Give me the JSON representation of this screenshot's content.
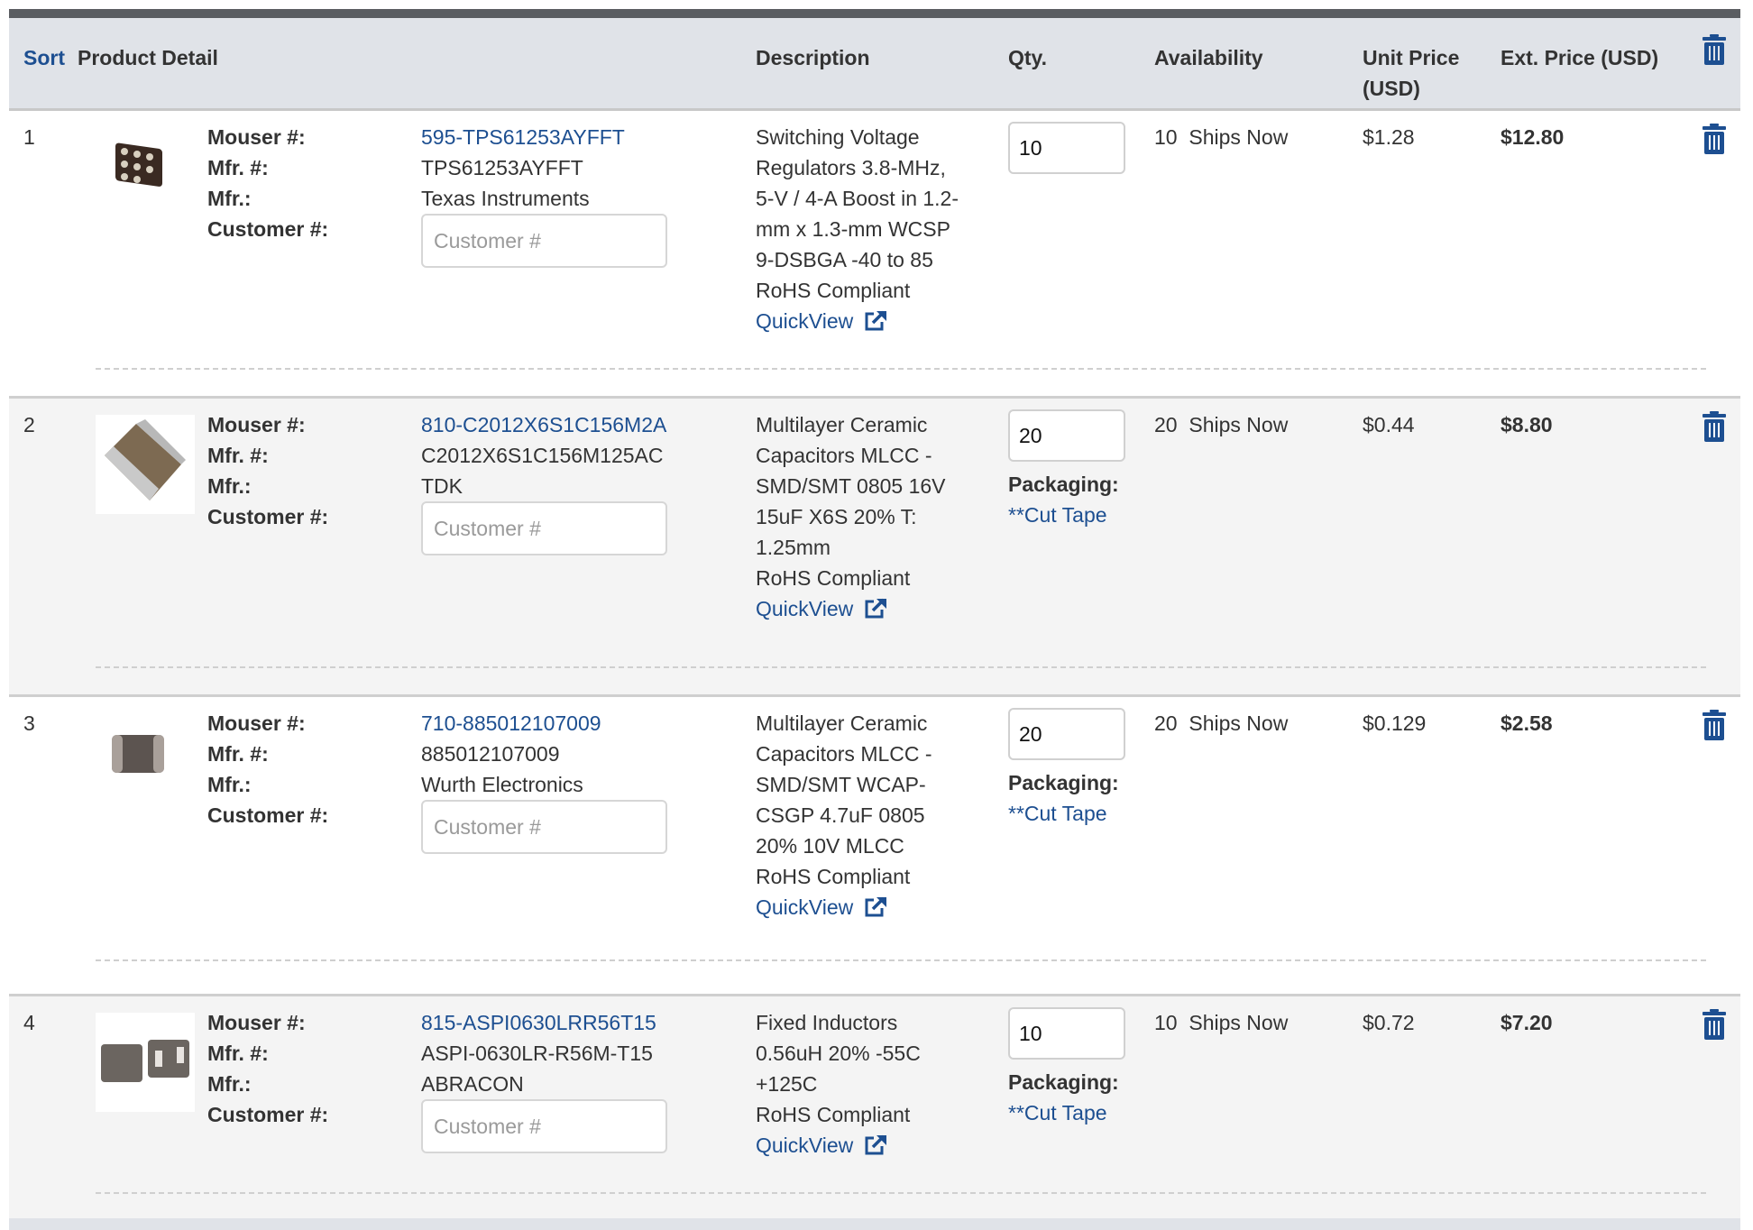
{
  "header": {
    "sort": "Sort",
    "product_detail": "Product Detail",
    "description": "Description",
    "qty": "Qty.",
    "availability": "Availability",
    "unit_price_line1": "Unit Price",
    "unit_price_line2": "(USD)",
    "ext_price": "Ext. Price (USD)",
    "delete_all_icon": "trash-icon"
  },
  "labels": {
    "mouser": "Mouser #:",
    "mfr_num": "Mfr. #:",
    "mfr": "Mfr.:",
    "customer": "Customer #:",
    "customer_placeholder": "Customer #",
    "packaging": "Packaging:",
    "quickview": "QuickView",
    "rohs": "RoHS Compliant"
  },
  "colors": {
    "link": "#1d4f91",
    "header_bg": "#e0e3e8",
    "topbar": "#5a5d61",
    "alt_row": "#f4f4f4"
  },
  "rows": [
    {
      "index": "1",
      "mouser_no": "595-TPS61253AYFFT",
      "mfr_no": "TPS61253AYFFT",
      "mfr": "Texas Instruments",
      "customer_no": "",
      "description": [
        "Switching Voltage",
        "Regulators 3.8-MHz,",
        "5-V / 4-A Boost in 1.2-",
        "mm x 1.3-mm WCSP",
        "9-DSBGA -40 to 85"
      ],
      "qty": "10",
      "packaging": "",
      "availability_qty": "10",
      "availability_text": "Ships Now",
      "unit_price": "$1.28",
      "ext_price": "$12.80"
    },
    {
      "index": "2",
      "mouser_no": "810-C2012X6S1C156M2A",
      "mfr_no": "C2012X6S1C156M125AC",
      "mfr": "TDK",
      "customer_no": "",
      "description": [
        "Multilayer Ceramic",
        "Capacitors MLCC -",
        "SMD/SMT 0805 16V",
        "15uF X6S 20% T:",
        "1.25mm"
      ],
      "qty": "20",
      "packaging": "**Cut Tape",
      "availability_qty": "20",
      "availability_text": "Ships Now",
      "unit_price": "$0.44",
      "ext_price": "$8.80"
    },
    {
      "index": "3",
      "mouser_no": "710-885012107009",
      "mfr_no": "885012107009",
      "mfr": "Wurth Electronics",
      "customer_no": "",
      "description": [
        "Multilayer Ceramic",
        "Capacitors MLCC -",
        "SMD/SMT WCAP-",
        "CSGP 4.7uF 0805",
        "20% 10V MLCC"
      ],
      "qty": "20",
      "packaging": "**Cut Tape",
      "availability_qty": "20",
      "availability_text": "Ships Now",
      "unit_price": "$0.129",
      "ext_price": "$2.58"
    },
    {
      "index": "4",
      "mouser_no": "815-ASPI0630LRR56T15",
      "mfr_no": "ASPI-0630LR-R56M-T15",
      "mfr": "ABRACON",
      "customer_no": "",
      "description": [
        "Fixed Inductors",
        "0.56uH 20% -55C",
        "+125C"
      ],
      "qty": "10",
      "packaging": "**Cut Tape",
      "availability_qty": "10",
      "availability_text": "Ships Now",
      "unit_price": "$0.72",
      "ext_price": "$7.20"
    }
  ]
}
